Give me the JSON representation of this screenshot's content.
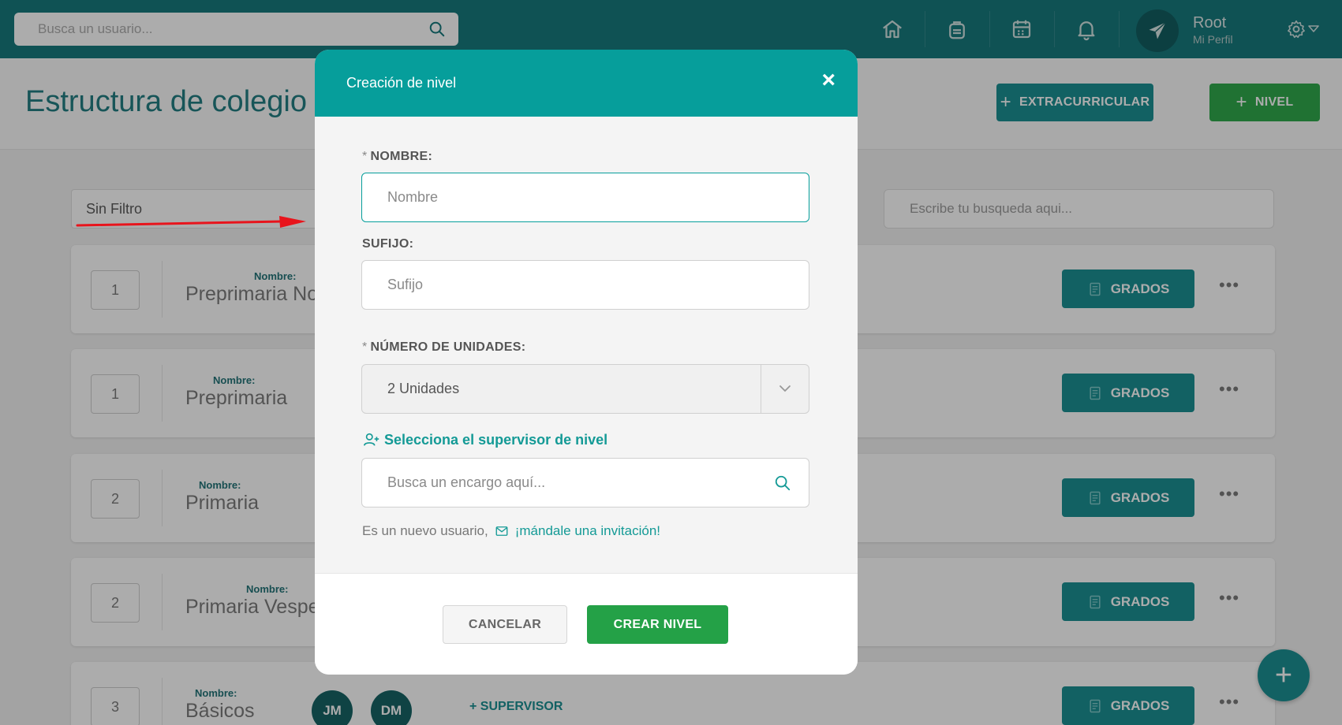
{
  "topbar": {
    "search_placeholder": "Busca un usuario...",
    "user_name": "Root",
    "user_sub": "Mi Perfil"
  },
  "header": {
    "title": "Estructura de colegio",
    "btn_extracurricular": "EXTRACURRICULAR",
    "btn_nivel": "NIVEL"
  },
  "filters": {
    "filter_value": "Sin Filtro",
    "search_placeholder": "Escribe tu busqueda aqui..."
  },
  "rows": [
    {
      "order": "1",
      "label": "Nombre:",
      "name": "Preprimaria No",
      "grados": "GRADOS"
    },
    {
      "order": "1",
      "label": "Nombre:",
      "name": "Preprimaria",
      "grados": "GRADOS"
    },
    {
      "order": "2",
      "label": "Nombre:",
      "name": "Primaria",
      "grados": "GRADOS"
    },
    {
      "order": "2",
      "label": "Nombre:",
      "name": "Primaria Vesper",
      "grados": "GRADOS"
    },
    {
      "order": "3",
      "label": "Nombre:",
      "name": "Básicos",
      "grados": "GRADOS",
      "supervisors": [
        "JM",
        "DM"
      ],
      "add_supervisor": "+ SUPERVISOR"
    }
  ],
  "modal": {
    "title": "Creación de nivel",
    "close": "×",
    "nombre_label": "NOMBRE:",
    "nombre_placeholder": "Nombre",
    "sufijo_label": "SUFIJO:",
    "sufijo_placeholder": "Sufijo",
    "unidades_label": "NÚMERO DE UNIDADES:",
    "unidades_value": "2 Unidades",
    "required_mark": "*",
    "supervisor_link": "Selecciona el supervisor de nivel",
    "supervisor_placeholder": "Busca un encargo aquí...",
    "invite_text": "Es un nuevo usuario,",
    "invite_link": "¡mándale una invitación!",
    "cancel": "CANCELAR",
    "create": "CREAR NIVEL"
  },
  "fab": {
    "label": "+"
  },
  "colors": {
    "primary": "#0e7579",
    "teal": "#138c8f",
    "modal_header": "#069e9b",
    "success": "#28a745",
    "annotation_arrow": "#e8141c"
  },
  "icons": [
    "search-icon",
    "home-icon",
    "backpack-icon",
    "calendar-icon",
    "bell-icon",
    "paper-plane-icon",
    "gear-icon",
    "book-icon",
    "more-icon",
    "user-plus-icon",
    "envelope-icon",
    "chevron-down-icon",
    "close-icon",
    "plus-icon"
  ]
}
